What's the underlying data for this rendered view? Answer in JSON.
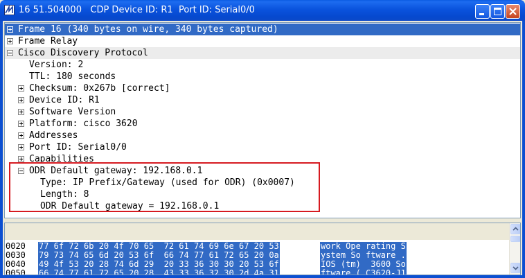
{
  "window": {
    "title": "16 51.504000   CDP Device ID: R1  Port ID: Serial0/0"
  },
  "tree": [
    {
      "label": "Frame 16 (340 bytes on wire, 340 bytes captured)",
      "expander": "plus",
      "level": 0,
      "state": "selected"
    },
    {
      "label": "Frame Relay",
      "expander": "plus",
      "level": 0,
      "state": "normal"
    },
    {
      "label": "Cisco Discovery Protocol",
      "expander": "minus",
      "level": 0,
      "state": "grey"
    },
    {
      "label": "Version: 2",
      "expander": "none",
      "level": 1,
      "state": "normal"
    },
    {
      "label": "TTL: 180 seconds",
      "expander": "none",
      "level": 1,
      "state": "normal"
    },
    {
      "label": "Checksum: 0x267b [correct]",
      "expander": "plus",
      "level": 1,
      "state": "normal"
    },
    {
      "label": "Device ID: R1",
      "expander": "plus",
      "level": 1,
      "state": "normal"
    },
    {
      "label": "Software Version",
      "expander": "plus",
      "level": 1,
      "state": "normal"
    },
    {
      "label": "Platform: cisco 3620",
      "expander": "plus",
      "level": 1,
      "state": "normal"
    },
    {
      "label": "Addresses",
      "expander": "plus",
      "level": 1,
      "state": "normal"
    },
    {
      "label": "Port ID: Serial0/0",
      "expander": "plus",
      "level": 1,
      "state": "normal"
    },
    {
      "label": "Capabilities",
      "expander": "plus",
      "level": 1,
      "state": "normal"
    },
    {
      "label": "ODR Default gateway: 192.168.0.1",
      "expander": "minus",
      "level": 1,
      "state": "normal"
    },
    {
      "label": "Type: IP Prefix/Gateway (used for ODR) (0x0007)",
      "expander": "none",
      "level": 2,
      "state": "normal"
    },
    {
      "label": "Length: 8",
      "expander": "none",
      "level": 2,
      "state": "normal"
    },
    {
      "label": "ODR Default gateway = 192.168.0.1",
      "expander": "none",
      "level": 2,
      "state": "normal"
    }
  ],
  "hex": [
    {
      "offset": "0020",
      "bytes": "77 6f 72 6b 20 4f 70 65  72 61 74 69 6e 67 20 53",
      "ascii": "work Ope rating S"
    },
    {
      "offset": "0030",
      "bytes": "79 73 74 65 6d 20 53 6f  66 74 77 61 72 65 20 0a",
      "ascii": "ystem So ftware ."
    },
    {
      "offset": "0040",
      "bytes": "49 4f 53 20 28 74 6d 29  20 33 36 30 30 20 53 6f",
      "ascii": "IOS (tm)  3600 So"
    },
    {
      "offset": "0050",
      "bytes": "66 74 77 61 72 65 20 28  43 33 36 32 30 2d 4a 31",
      "ascii": "ftware ( C3620-J1"
    }
  ],
  "colors": {
    "selection": "#316ac5",
    "highlight_box": "#d61a20",
    "titlebar": "#0a53dd"
  }
}
